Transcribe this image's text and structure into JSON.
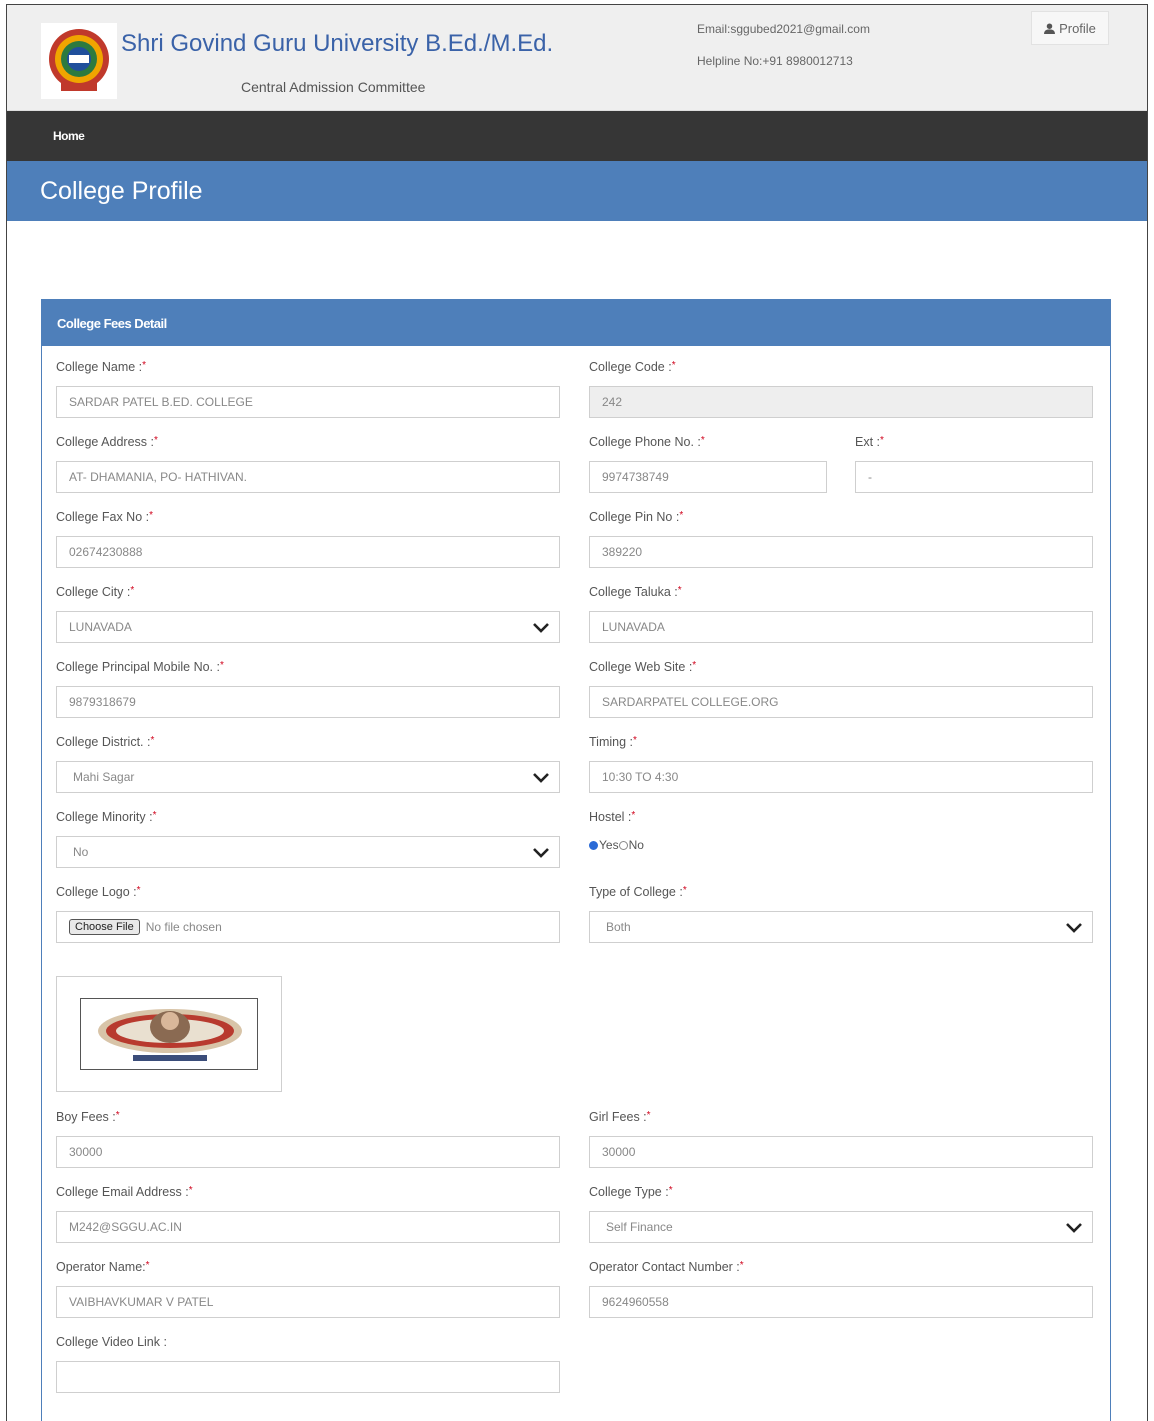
{
  "header": {
    "title": "Shri Govind Guru University B.Ed./M.Ed.",
    "subtitle": "Central Admission Committee",
    "email": "Email:sggubed2021@gmail.com",
    "helpline": "Helpline No:+91 8980012713",
    "profile_label": "Profile"
  },
  "nav": {
    "home": "Home"
  },
  "page": {
    "title": "College Profile"
  },
  "panel": {
    "title": "College Fees Detail"
  },
  "form": {
    "college_name": {
      "label": "College Name :",
      "value": "SARDAR PATEL B.ED. COLLEGE"
    },
    "college_code": {
      "label": "College Code :",
      "value": "242"
    },
    "college_address": {
      "label": "College Address :",
      "value": "AT- DHAMANIA,  PO- HATHIVAN."
    },
    "college_phone": {
      "label": "College Phone No. :",
      "value": "9974738749"
    },
    "ext": {
      "label": "Ext :",
      "value": "-"
    },
    "fax": {
      "label": "College Fax No :",
      "value": "02674230888"
    },
    "pin": {
      "label": "College Pin No :",
      "value": "389220"
    },
    "city": {
      "label": "College City :",
      "value": "LUNAVADA"
    },
    "taluka": {
      "label": "College Taluka :",
      "value": "LUNAVADA"
    },
    "principal_mobile": {
      "label": "College Principal Mobile No. :",
      "value": "9879318679"
    },
    "website": {
      "label": "College Web Site :",
      "value": "SARDARPATEL COLLEGE.ORG"
    },
    "district": {
      "label": "College District. :",
      "value": "Mahi Sagar"
    },
    "timing": {
      "label": "Timing :",
      "value": "10:30 TO 4:30"
    },
    "minority": {
      "label": "College Minority :",
      "value": "No"
    },
    "hostel": {
      "label": "Hostel :",
      "yes": "Yes",
      "no": "No"
    },
    "logo": {
      "label": "College Logo :",
      "button": "Choose File",
      "status": "No file chosen"
    },
    "type_of_college": {
      "label": "Type of College :",
      "value": "Both"
    },
    "boy_fees": {
      "label": "Boy Fees :",
      "value": "30000"
    },
    "girl_fees": {
      "label": "Girl Fees :",
      "value": "30000"
    },
    "email": {
      "label": "College Email Address :",
      "value": "M242@SGGU.AC.IN"
    },
    "college_type": {
      "label": "College Type :",
      "value": "Self Finance"
    },
    "operator_name": {
      "label": "Operator Name:",
      "value": "VAIBHAVKUMAR V PATEL"
    },
    "operator_contact": {
      "label": "Operator Contact Number :",
      "value": "9624960558"
    },
    "video_link": {
      "label": "College Video Link :",
      "value": ""
    }
  },
  "colors": {
    "brand_blue": "#4e7fba",
    "nav_dark": "#363636",
    "title_blue": "#3a62a8"
  }
}
